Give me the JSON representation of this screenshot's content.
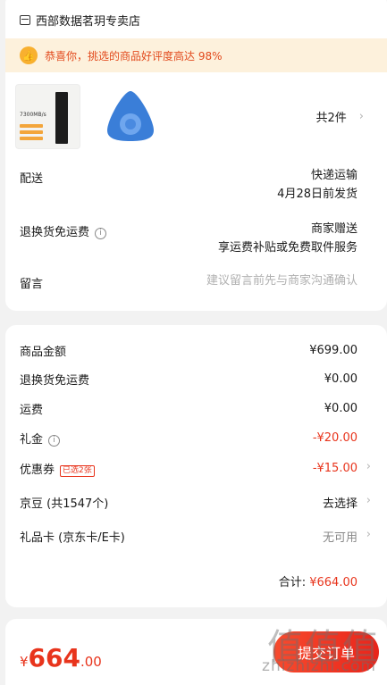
{
  "shop": {
    "name": "西部数据茗玥专卖店",
    "icon": "shop-icon"
  },
  "promo": {
    "text": "恭喜你，挑选的商品好评度高达 98%",
    "icon": "thumb-up-icon"
  },
  "products": {
    "count_label": "共2件",
    "ssd_thumb_text": "7300MB/s"
  },
  "delivery": {
    "label": "配送",
    "method": "快递运输",
    "date": "4月28日前发货"
  },
  "return": {
    "label": "退换货免运费",
    "line1": "商家赠送",
    "line2": "享运费补贴或免费取件服务"
  },
  "note": {
    "label": "留言",
    "placeholder": "建议留言前先与商家沟通确认"
  },
  "summary": {
    "goods_label": "商品金额",
    "goods_value": "¥699.00",
    "return_label": "退换货免运费",
    "return_value": "¥0.00",
    "shipping_label": "运费",
    "shipping_value": "¥0.00",
    "gift_label": "礼金",
    "gift_value": "-¥20.00",
    "coupon_label": "优惠券",
    "coupon_badge": "已选2张",
    "coupon_value": "-¥15.00",
    "jingdou_label": "京豆 (共1547个)",
    "jingdou_value": "去选择",
    "giftcard_label": "礼品卡 (京东卡/E卡)",
    "giftcard_value": "无可用",
    "total_label": "合计:",
    "total_value": "¥664.00"
  },
  "bottom": {
    "currency": "¥",
    "price_int": "664",
    "price_dec": ".00",
    "submit_label": "提交订单"
  },
  "watermark": {
    "text": "值值值",
    "url": "zhizhizhi.com"
  },
  "colors": {
    "accent": "#e8341c",
    "promo_bg": "#fdf1dc",
    "badge_yellow": "#f8b02f"
  }
}
